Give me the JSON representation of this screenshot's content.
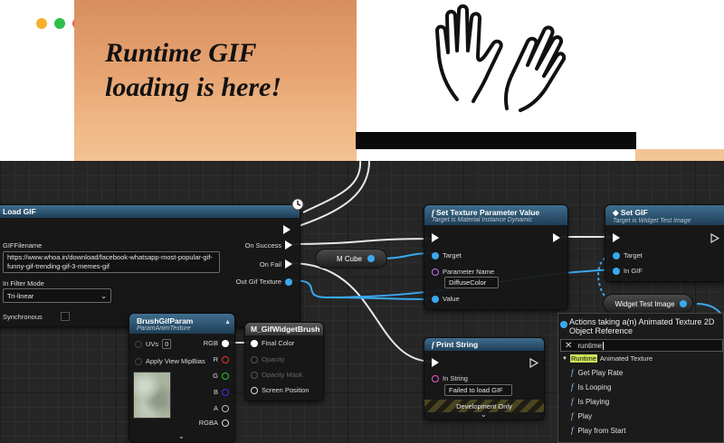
{
  "window": {
    "traffic_lights": [
      "#f6b02d",
      "#2dbf4b",
      "#f2545b"
    ]
  },
  "preview": {
    "headline_line1": "Runtime GIF",
    "headline_line2": "loading is here!"
  },
  "graph": {
    "load_gif": {
      "title": "Load GIF",
      "on_success": "On Success",
      "on_fail": "On Fail",
      "gif_filename_label": "GIFFilename",
      "gif_filename_value": "https://www.whoa.in/download/facebook-whatsapp-most-popular-gif-funny-gif-trending-gif-3-memes-gif",
      "out_gif_texture": "Out Gif Texture",
      "in_filter_mode_label": "In Filter Mode",
      "in_filter_mode_value": "Tri-linear",
      "synchronous_label": "Synchronous"
    },
    "m_cube": {
      "label": "M Cube"
    },
    "set_texture": {
      "title": "Set Texture Parameter Value",
      "subtitle": "Target is Material Instance Dynamic",
      "target": "Target",
      "parameter_name_label": "Parameter Name",
      "parameter_name_value": "DiffuseColor",
      "value": "Value"
    },
    "set_gif": {
      "title": "Set GIF",
      "subtitle": "Target is Widget Test Image",
      "target": "Target",
      "in_gif": "In GIF"
    },
    "widget_test_image": {
      "label": "Widget Test Image"
    },
    "brush_param": {
      "title": "BrushGifParam",
      "subtitle": "ParamAnimTexture",
      "uvs": "UVs",
      "uvs_value": "0",
      "apply_mip": "Apply View MipBias",
      "rgb": "RGB",
      "r": "R",
      "g": "G",
      "b": "B",
      "a": "A",
      "rgba": "RGBA"
    },
    "widget_brush": {
      "title": "M_GifWidgetBrush",
      "final_color": "Final Color",
      "opacity": "Opacity",
      "opacity_mask": "Opacity Mask",
      "screen_position": "Screen Position"
    },
    "print_string": {
      "title": "Print String",
      "in_string": "In String",
      "in_string_value": "Failed to load GIF",
      "dev_only": "Development Only"
    },
    "action_menu": {
      "title": "Actions taking a(n) Animated Texture 2D Object Reference",
      "search_value": "runtime",
      "category_highlight": "Runtime",
      "category_rest": "Animated Texture",
      "items": [
        "Get Play Rate",
        "Is Looping",
        "Is Playing",
        "Play",
        "Play from Start"
      ],
      "item_icon": "f"
    }
  },
  "colors": {
    "exec": "#ffffff",
    "object_pin": "#3aa9f0",
    "string_pin": "#e95bd8",
    "func_header": "#2d5877"
  }
}
